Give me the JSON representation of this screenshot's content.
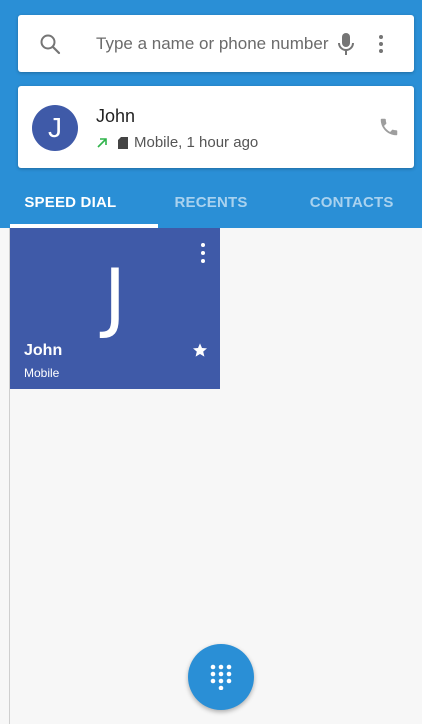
{
  "search": {
    "placeholder": "Type a name or phone number",
    "search_icon": "search-icon",
    "mic_icon": "microphone-icon",
    "more_icon": "more-vert-icon"
  },
  "recent_call": {
    "avatar_letter": "J",
    "name": "John",
    "detail": "Mobile, 1 hour ago",
    "call_type_icon": "outgoing-call-arrow-icon",
    "sim_icon": "sim-card-icon",
    "call_icon": "phone-icon"
  },
  "tabs": [
    {
      "label": "SPEED DIAL",
      "active": true
    },
    {
      "label": "RECENTS",
      "active": false
    },
    {
      "label": "CONTACTS",
      "active": false
    }
  ],
  "speed_dial": {
    "tiles": [
      {
        "letter": "J",
        "name": "John",
        "type": "Mobile",
        "starred": true
      }
    ]
  },
  "fab": {
    "icon": "dialpad-icon"
  },
  "colors": {
    "primary": "#2a8fd6",
    "tile_bg": "#3f5aa8",
    "outgoing_arrow": "#2fb34a"
  }
}
